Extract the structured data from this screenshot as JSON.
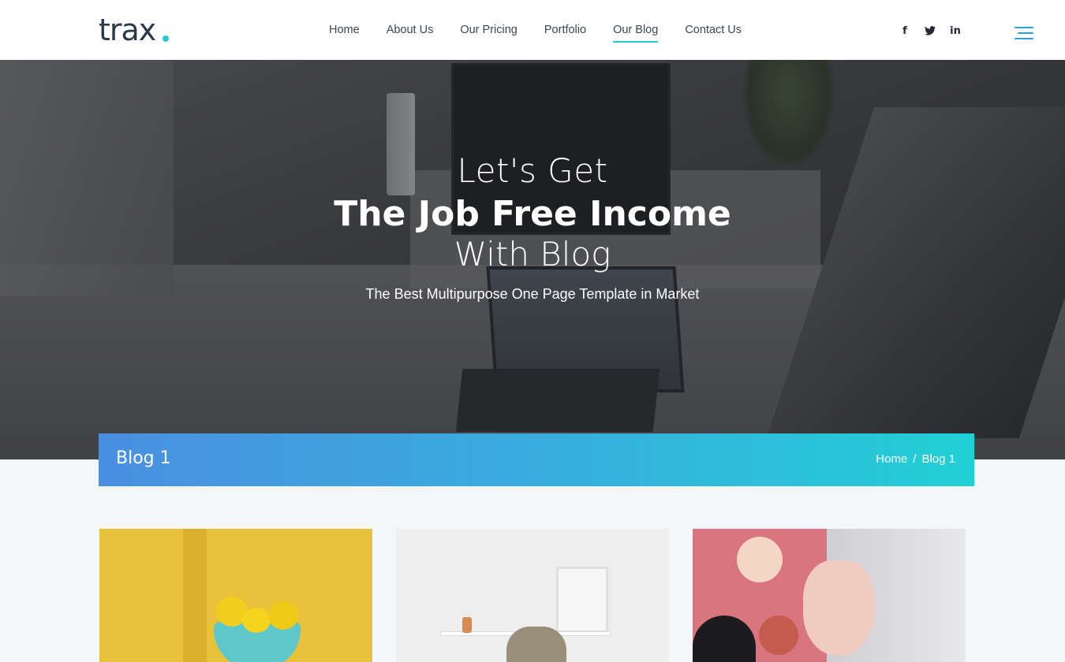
{
  "header": {
    "logo": "trax",
    "nav": [
      {
        "label": "Home",
        "active": false
      },
      {
        "label": "About Us",
        "active": false
      },
      {
        "label": "Our Pricing",
        "active": false
      },
      {
        "label": "Portfolio",
        "active": false
      },
      {
        "label": "Our Blog",
        "active": true
      },
      {
        "label": "Contact Us",
        "active": false
      }
    ],
    "social": [
      {
        "icon": "facebook-icon",
        "glyph": "f"
      },
      {
        "icon": "twitter-icon",
        "glyph": "t"
      },
      {
        "icon": "linkedin-icon",
        "glyph": "in"
      }
    ],
    "menu_icon": "hamburger-menu-icon"
  },
  "hero": {
    "line1": "Let's Get",
    "line2": "The Job Free Income",
    "line3": "With Blog",
    "subtitle": "The Best Multipurpose One Page Template in Market"
  },
  "breadcrumb_bar": {
    "title": "Blog 1",
    "crumbs": [
      "Home",
      "Blog 1"
    ],
    "separator": "/"
  },
  "colors": {
    "accent": "#28c7d4",
    "gradient_start": "#4a8fe0",
    "gradient_end": "#22cfd6"
  }
}
